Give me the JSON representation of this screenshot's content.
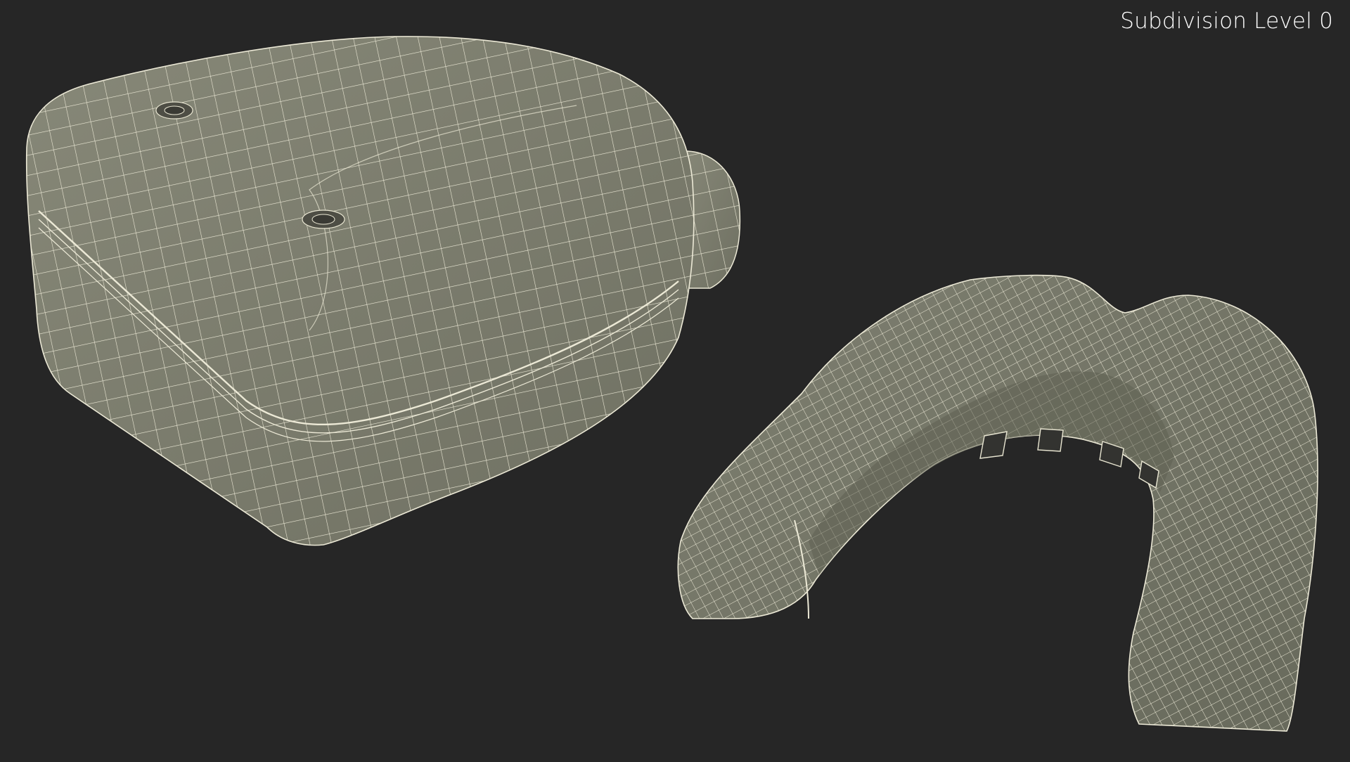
{
  "viewport": {
    "overlay_label": "Subdivision Level 0",
    "background_color": "#262626"
  },
  "scene": {
    "objects": [
      "mouthguard-case",
      "mouthguard"
    ],
    "render_style": "wireframe-over-shaded",
    "surface_color": "#7b7c6c",
    "wire_color": "#ece9d6"
  }
}
